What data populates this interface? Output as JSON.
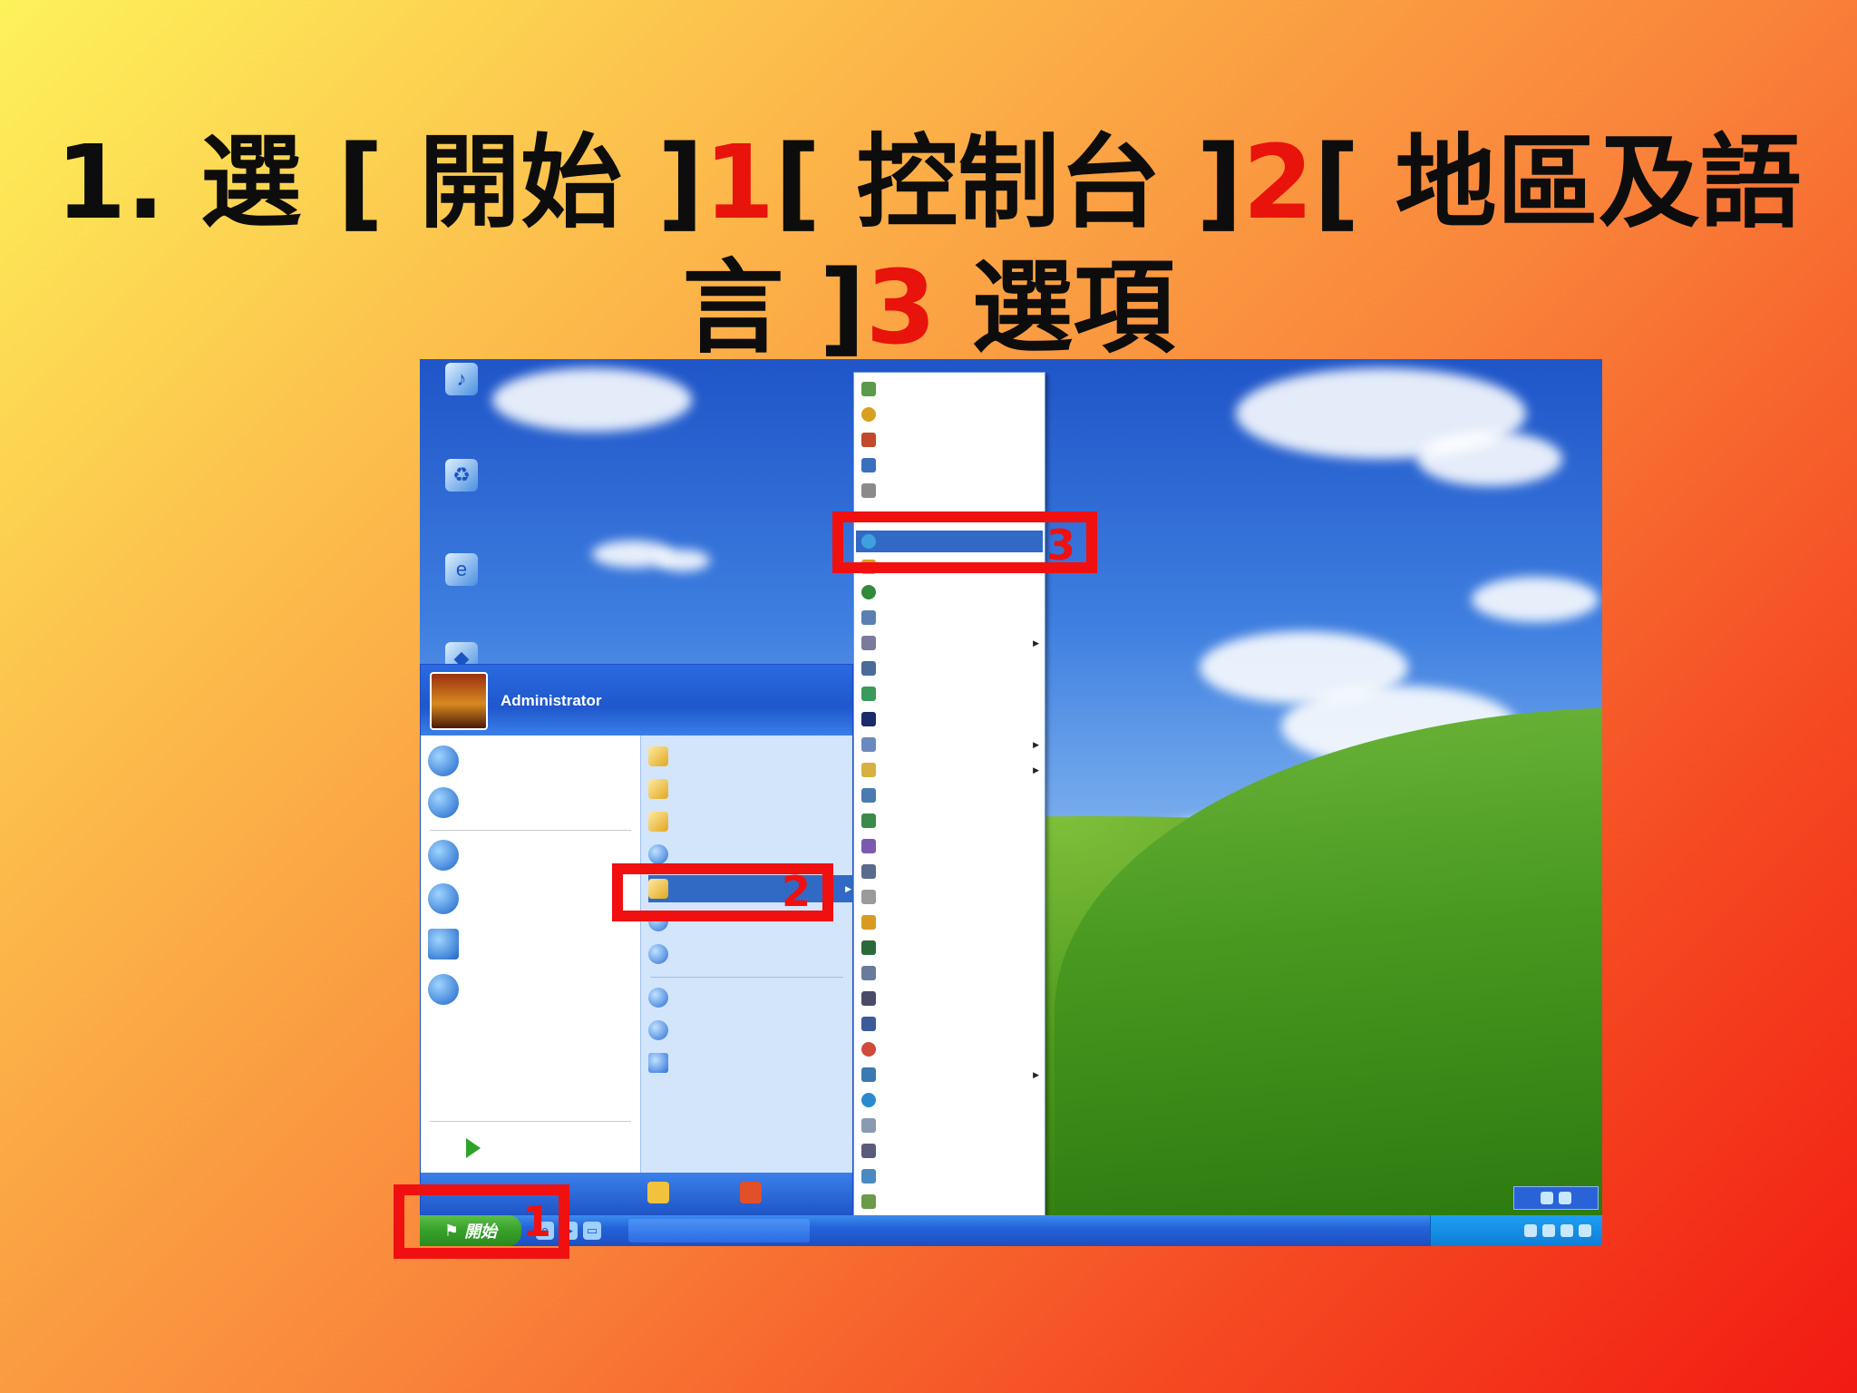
{
  "title": {
    "line1_a": "1. 選 [ 開始 ]",
    "line1_n1": "1",
    "line1_b": "[ 控制台 ]",
    "line1_n2": "2",
    "line1_c": "[ 地區及語",
    "line2_a": "言 ]",
    "line2_n3": "3",
    "line2_b": " 選項"
  },
  "colors": {
    "highlight_red": "#e8130b",
    "xp_blue": "#1f57cc",
    "xp_start_green": "#37a02a"
  },
  "start_menu": {
    "username": "Administrator"
  },
  "taskbar": {
    "start_label": "開始"
  },
  "callouts": {
    "one": "1",
    "two": "2",
    "three": "3"
  }
}
